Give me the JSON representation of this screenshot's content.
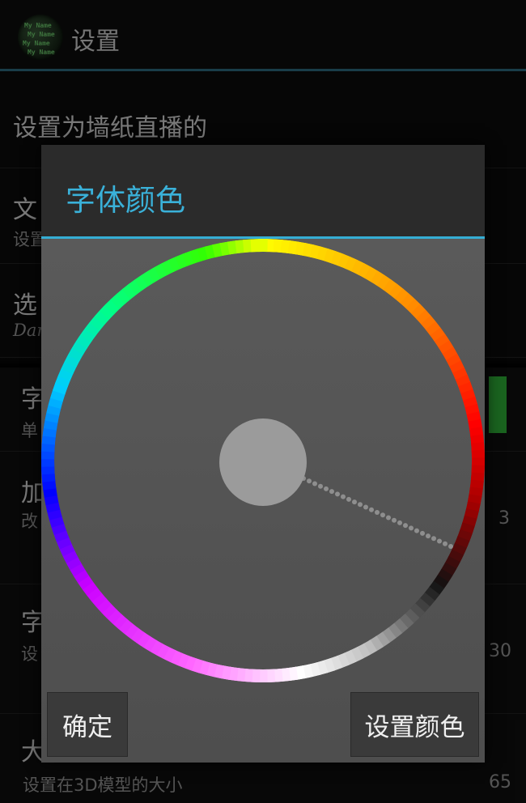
{
  "actionbar": {
    "title": "设置",
    "icon": "app-logo-icon",
    "logo_lines": [
      "My Name",
      "My Name",
      "My Name",
      "My Name"
    ]
  },
  "settings": {
    "live_wallpaper": {
      "title": "设置为墙纸直播的"
    },
    "text": {
      "title": "文",
      "subtitle": "设置"
    },
    "select": {
      "title": "选",
      "subtitle": "Dan"
    },
    "font_color": {
      "title": "字",
      "subtitle": "单",
      "color": "#31b53a"
    },
    "speed": {
      "title": "加",
      "subtitle": "改",
      "value": "3"
    },
    "font_size": {
      "title": "字",
      "subtitle": "设",
      "value": "30"
    },
    "size": {
      "title": "大",
      "subtitle": "设置在3D模型的大小",
      "value": "65"
    }
  },
  "dialog": {
    "title": "字体颜色",
    "ok_label": "确定",
    "set_color_label": "设置颜色",
    "accent": "#35aed4",
    "selected_color": "#9b9b9b",
    "picker": "hue-ring-color-wheel"
  }
}
